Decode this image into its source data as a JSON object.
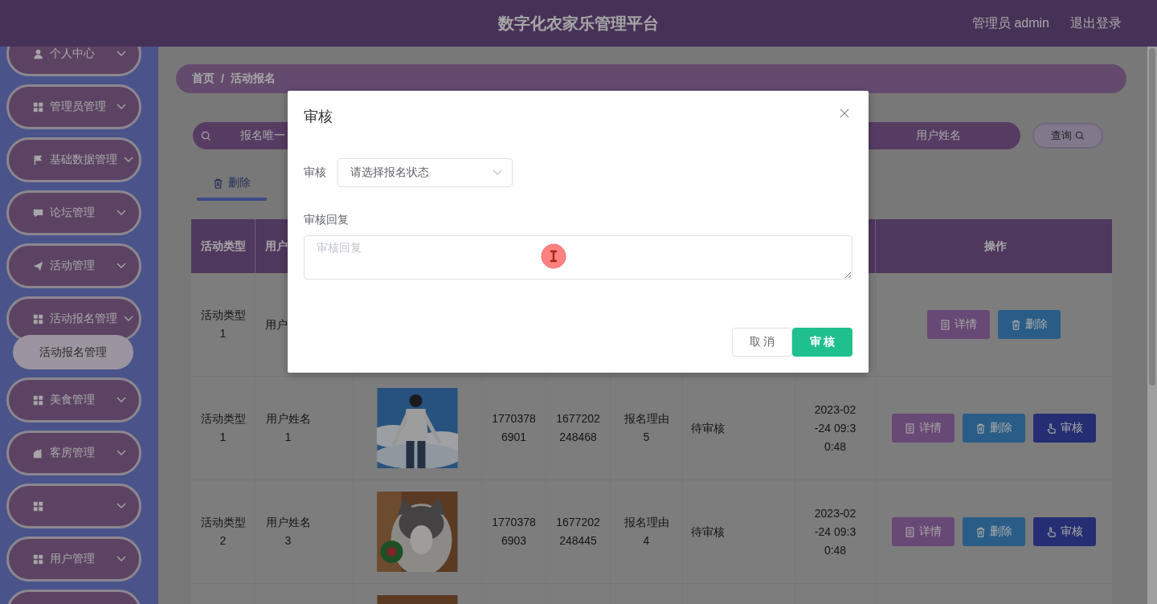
{
  "header": {
    "title": "数字化农家乐管理平台",
    "user": "管理员 admin",
    "logout": "退出登录"
  },
  "sidebar": {
    "items": [
      {
        "kind": "group",
        "label": "个人中心"
      },
      {
        "kind": "group",
        "label": "管理员管理"
      },
      {
        "kind": "group",
        "label": "基础数据管理"
      },
      {
        "kind": "group",
        "label": "论坛管理"
      },
      {
        "kind": "group",
        "label": "活动管理"
      },
      {
        "kind": "group",
        "label": "活动报名管理",
        "children": [
          {
            "label": "活动报名管理",
            "selected": true
          }
        ]
      },
      {
        "kind": "group",
        "label": "美食管理"
      },
      {
        "kind": "group",
        "label": "客房管理"
      },
      {
        "kind": "group"
      },
      {
        "kind": "group",
        "label": "用户管理"
      },
      {
        "kind": "group"
      }
    ]
  },
  "breadcrumb": {
    "items": [
      "首页",
      "活动报名"
    ],
    "separator": "/"
  },
  "search": {
    "fields": [
      {
        "placeholder": "报名唯一"
      },
      {
        "placeholder": "用户姓名"
      }
    ],
    "button": "查询"
  },
  "toolbar": {
    "delete_button": "删除"
  },
  "table": {
    "columns": {
      "activity_type": "活动类型",
      "user": "用户",
      "actions": "操作"
    },
    "rows": [
      {
        "activity_type": "活动类型1",
        "user": "用户",
        "actions": [
          {
            "kind": "details",
            "label": "详情"
          },
          {
            "kind": "delete",
            "label": "删除"
          }
        ]
      },
      {
        "activity_type": "活动类型1",
        "user": "用户姓名1",
        "image": {
          "kind": "picture"
        },
        "phone": "17703786901",
        "signup_id": "1677202248468",
        "reason": "报名理由5",
        "status": "待审核",
        "time": "2023-02-24 09:30:48",
        "actions": [
          {
            "kind": "details",
            "label": "详情"
          },
          {
            "kind": "delete",
            "label": "删除"
          },
          {
            "kind": "audit",
            "label": "审核"
          }
        ]
      },
      {
        "activity_type": "活动类型2",
        "user": "用户姓名3",
        "image": {
          "kind": "picture"
        },
        "phone": "17703786903",
        "signup_id": "1677202248445",
        "reason": "报名理由4",
        "status": "待审核",
        "time": "2023-02-24 09:30:48",
        "actions": [
          {
            "kind": "details",
            "label": "详情"
          },
          {
            "kind": "delete",
            "label": "删除"
          },
          {
            "kind": "audit",
            "label": "审核"
          }
        ]
      },
      {
        "image": {
          "kind": "picture"
        }
      }
    ]
  },
  "dialog": {
    "title": "审核",
    "fields": [
      {
        "kind": "select",
        "label": "审核",
        "placeholder": "请选择报名状态"
      },
      {
        "kind": "textarea",
        "label": "审核回复",
        "placeholder": "审核回复"
      }
    ],
    "buttons": [
      {
        "kind": "cancel",
        "label": "取消"
      },
      {
        "kind": "confirm",
        "label": "审核"
      }
    ]
  }
}
